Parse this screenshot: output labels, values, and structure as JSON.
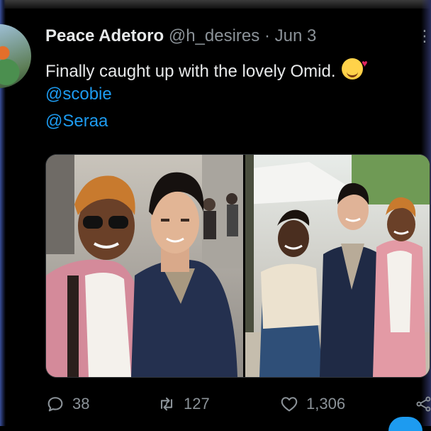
{
  "tweet": {
    "author_name": "Peace Adetoro",
    "author_handle": "@h_desires",
    "separator": "·",
    "date": "Jun 3",
    "text": "Finally caught up with the lovely Omid.",
    "emoji": "smiling-face-with-hearts",
    "mentions": [
      "@scobie",
      "@Seraa"
    ]
  },
  "media": {
    "photos": [
      {
        "name": "selfie-photo"
      },
      {
        "name": "group-photo"
      }
    ]
  },
  "actions": {
    "reply_count": "38",
    "retweet_count": "127",
    "like_count": "1,306"
  },
  "colors": {
    "background": "#000000",
    "text": "#e7e9ea",
    "secondary": "#8b9298",
    "link": "#1d9bf0"
  }
}
